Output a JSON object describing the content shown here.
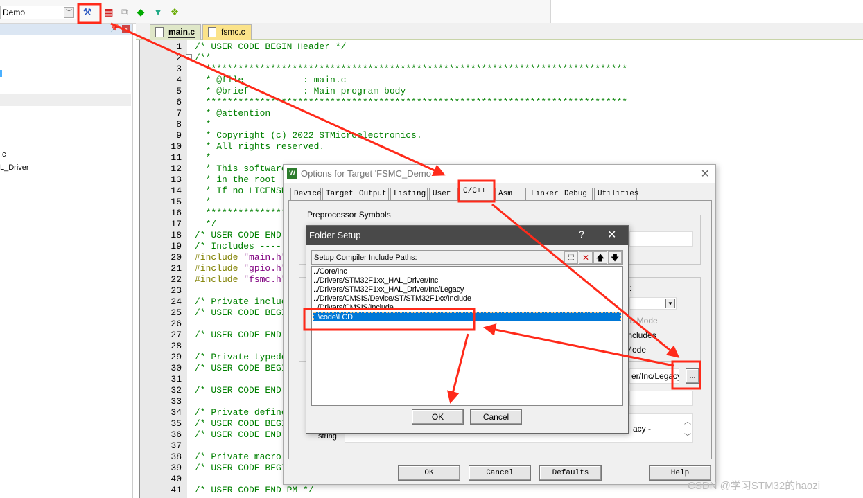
{
  "toolbar": {
    "target": "Demo",
    "icons": [
      "options-for-target-icon",
      "manage-components-icon",
      "select-packs-icon",
      "pack-installer-icon",
      "filter-icon",
      "layers-icon"
    ]
  },
  "sidebar": {
    "items": [
      ".c",
      "L_Driver"
    ]
  },
  "editor": {
    "tabs": [
      {
        "label": "main.c",
        "active": true
      },
      {
        "label": "fsmc.c",
        "active": false
      }
    ],
    "lines": [
      {
        "n": "1",
        "t": "/* USER CODE BEGIN Header */"
      },
      {
        "n": "2",
        "t": "/**"
      },
      {
        "n": "3",
        "t": "  ******************************************************************************"
      },
      {
        "n": "4",
        "t": "  * @file           : main.c"
      },
      {
        "n": "5",
        "t": "  * @brief          : Main program body"
      },
      {
        "n": "6",
        "t": "  ******************************************************************************"
      },
      {
        "n": "7",
        "t": "  * @attention"
      },
      {
        "n": "8",
        "t": "  *"
      },
      {
        "n": "9",
        "t": "  * Copyright (c) 2022 STMicroelectronics."
      },
      {
        "n": "10",
        "t": "  * All rights reserved."
      },
      {
        "n": "11",
        "t": "  *"
      },
      {
        "n": "12",
        "t": "  * This software"
      },
      {
        "n": "13",
        "t": "  * in the root"
      },
      {
        "n": "14",
        "t": "  * If no LICENSE"
      },
      {
        "n": "15",
        "t": "  *"
      },
      {
        "n": "16",
        "t": "  ******************"
      },
      {
        "n": "17",
        "t": "  */"
      },
      {
        "n": "18",
        "t": "/* USER CODE END"
      },
      {
        "n": "19",
        "t": "/* Includes -----"
      },
      {
        "n": "20",
        "t": "#include ",
        "s": "\"main.h\""
      },
      {
        "n": "21",
        "t": "#include ",
        "s": "\"gpio.h\""
      },
      {
        "n": "22",
        "t": "#include ",
        "s": "\"fsmc.h\""
      },
      {
        "n": "23",
        "t": ""
      },
      {
        "n": "24",
        "t": "/* Private includ"
      },
      {
        "n": "25",
        "t": "/* USER CODE BEGI"
      },
      {
        "n": "26",
        "t": ""
      },
      {
        "n": "27",
        "t": "/* USER CODE END"
      },
      {
        "n": "28",
        "t": ""
      },
      {
        "n": "29",
        "t": "/* Private typede"
      },
      {
        "n": "30",
        "t": "/* USER CODE BEGI"
      },
      {
        "n": "31",
        "t": ""
      },
      {
        "n": "32",
        "t": "/* USER CODE END"
      },
      {
        "n": "33",
        "t": ""
      },
      {
        "n": "34",
        "t": "/* Private define"
      },
      {
        "n": "35",
        "t": "/* USER CODE BEGI"
      },
      {
        "n": "36",
        "t": "/* USER CODE END"
      },
      {
        "n": "37",
        "t": ""
      },
      {
        "n": "38",
        "t": "/* Private macro"
      },
      {
        "n": "39",
        "t": "/* USER CODE BEGI"
      },
      {
        "n": "40",
        "t": ""
      },
      {
        "n": "41",
        "t": "/* USER CODE END PM */"
      }
    ]
  },
  "options_dialog": {
    "title": "Options for Target 'FSMC_Demo",
    "tabs": [
      "Device",
      "Target",
      "Output",
      "Listing",
      "User",
      "C/C++",
      "Asm",
      "Linker",
      "Debug",
      "Utilities"
    ],
    "active_tab": "C/C++",
    "preprocessor_label": "Preprocessor Symbols",
    "partial_labels": {
      "s": "s:",
      "thumb": "nb Mode",
      "includes": "Includes",
      "mode": "Mode",
      "include_paths": "er/Inc/Legacy",
      "misc": "acy -",
      "string": "string"
    },
    "browse_label": "...",
    "buttons": {
      "ok": "OK",
      "cancel": "Cancel",
      "defaults": "Defaults",
      "help": "Help"
    }
  },
  "folder_setup": {
    "title": "Folder Setup",
    "help": "?",
    "label": "Setup Compiler Include Paths:",
    "paths": [
      "../Core/Inc",
      "../Drivers/STM32F1xx_HAL_Driver/Inc",
      "../Drivers/STM32F1xx_HAL_Driver/Inc/Legacy",
      "../Drivers/CMSIS/Device/ST/STM32F1xx/Include",
      "../Drivers/CMSIS/Include",
      "..\\code\\LCD"
    ],
    "selected_index": 5,
    "ok": "OK",
    "cancel": "Cancel"
  },
  "annotation_color": "#ff2a1a",
  "watermark": "CSDN @学习STM32的haozi"
}
